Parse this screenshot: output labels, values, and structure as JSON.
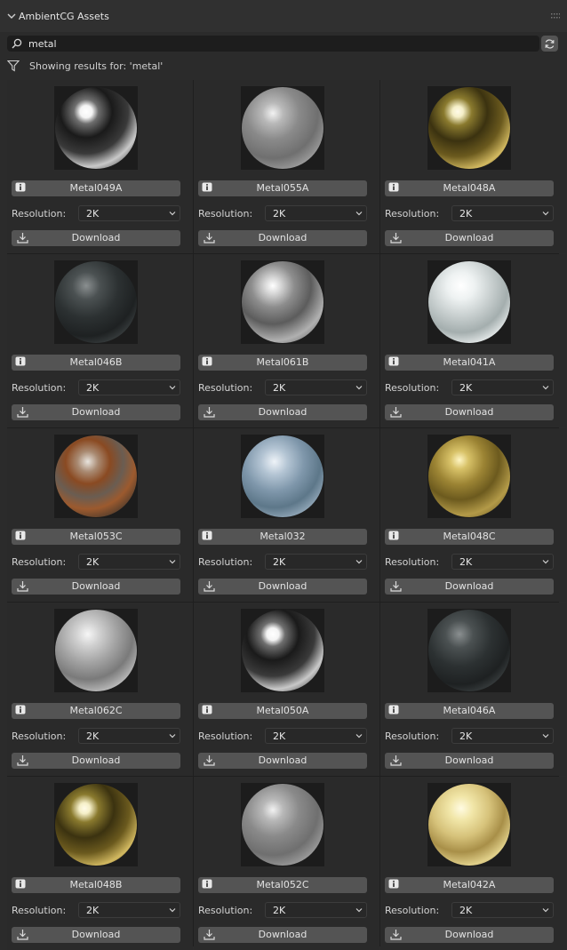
{
  "panel": {
    "title": "AmbientCG Assets"
  },
  "search": {
    "value": "metal"
  },
  "filter": {
    "text": "Showing results for: 'metal'"
  },
  "colors": {
    "panel_bg": "#2b2b2b",
    "button_bg": "#545454",
    "field_bg": "#1d1d1d"
  },
  "icons": {
    "collapse": "chevron-down-icon",
    "search": "search-icon",
    "refresh": "refresh-icon",
    "filter": "filter-icon",
    "info": "info-icon",
    "download": "download-icon",
    "dropdown": "chevron-down-icon"
  },
  "common": {
    "resolution_label": "Resolution:",
    "download_label": "Download"
  },
  "assets": [
    {
      "name": "Metal049A",
      "resolution": "2K",
      "material": "chrome"
    },
    {
      "name": "Metal055A",
      "resolution": "2K",
      "material": "brushed-silver"
    },
    {
      "name": "Metal048A",
      "resolution": "2K",
      "material": "gold-polished"
    },
    {
      "name": "Metal046B",
      "resolution": "2K",
      "material": "dark-steel"
    },
    {
      "name": "Metal061B",
      "resolution": "2K",
      "material": "silver"
    },
    {
      "name": "Metal041A",
      "resolution": "2K",
      "material": "pearl-silver"
    },
    {
      "name": "Metal053C",
      "resolution": "2K",
      "material": "rusty"
    },
    {
      "name": "Metal032",
      "resolution": "2K",
      "material": "blue-steel"
    },
    {
      "name": "Metal048C",
      "resolution": "2K",
      "material": "gold-worn"
    },
    {
      "name": "Metal062C",
      "resolution": "2K",
      "material": "scratched-silver"
    },
    {
      "name": "Metal050A",
      "resolution": "2K",
      "material": "chrome"
    },
    {
      "name": "Metal046A",
      "resolution": "2K",
      "material": "dark-steel"
    },
    {
      "name": "Metal048B",
      "resolution": "2K",
      "material": "gold-polished"
    },
    {
      "name": "Metal052C",
      "resolution": "2K",
      "material": "brushed-silver"
    },
    {
      "name": "Metal042A",
      "resolution": "2K",
      "material": "pale-gold"
    }
  ]
}
